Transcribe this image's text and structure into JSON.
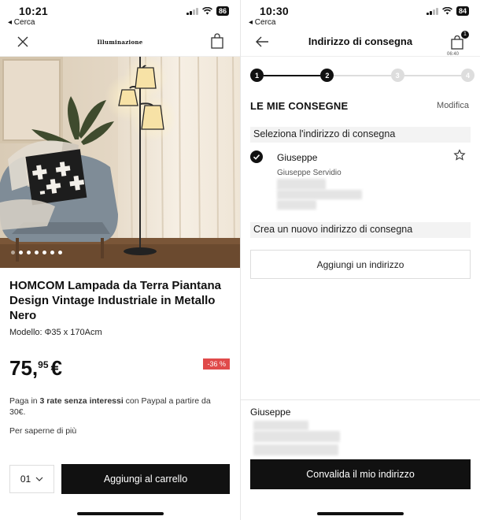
{
  "left": {
    "status": {
      "time": "10:21",
      "back": "◂ Cerca",
      "battery": "86"
    },
    "header": {
      "brand": "Illuminazione"
    },
    "carousel": {
      "dots": 7,
      "active_index": 0
    },
    "product": {
      "title": "HOMCOM Lampada da Terra Piantana Design Vintage Industriale in Metallo Nero",
      "model": "Modello: Φ35 x 170Acm",
      "price_int": "75,",
      "price_dec": "95",
      "price_cur": "€",
      "discount": "-36 %",
      "paypal_pre": "Paga in ",
      "paypal_bold": "3 rate senza interessi",
      "paypal_post": " con Paypal a partire da 30€.",
      "more": "Per saperne di più"
    },
    "qty": {
      "value": "01"
    },
    "add_to_cart": "Aggiungi al carrello"
  },
  "right": {
    "status": {
      "time": "10:30",
      "back": "◂ Cerca",
      "battery": "84"
    },
    "header": {
      "title": "Indirizzo di consegna",
      "bag_count": "1",
      "timer": "06:40"
    },
    "stepper": {
      "steps": [
        "1",
        "2",
        "3",
        "4"
      ],
      "current": 2
    },
    "section": {
      "title": "LE MIE CONSEGNE",
      "modify": "Modifica"
    },
    "select_label": "Seleziona l'indirizzo di consegna",
    "address": {
      "name": "Giuseppe",
      "full_name": "Giuseppe Servidio"
    },
    "create_label": "Crea un nuovo indirizzo di consegna",
    "add_address": "Aggiungi un indirizzo",
    "footer": {
      "name": "Giuseppe"
    },
    "validate": "Convalida il mio indirizzo"
  },
  "colors": {
    "discount": "#e04a4a",
    "primary": "#111111",
    "muted_bar": "#f3f3f3"
  }
}
